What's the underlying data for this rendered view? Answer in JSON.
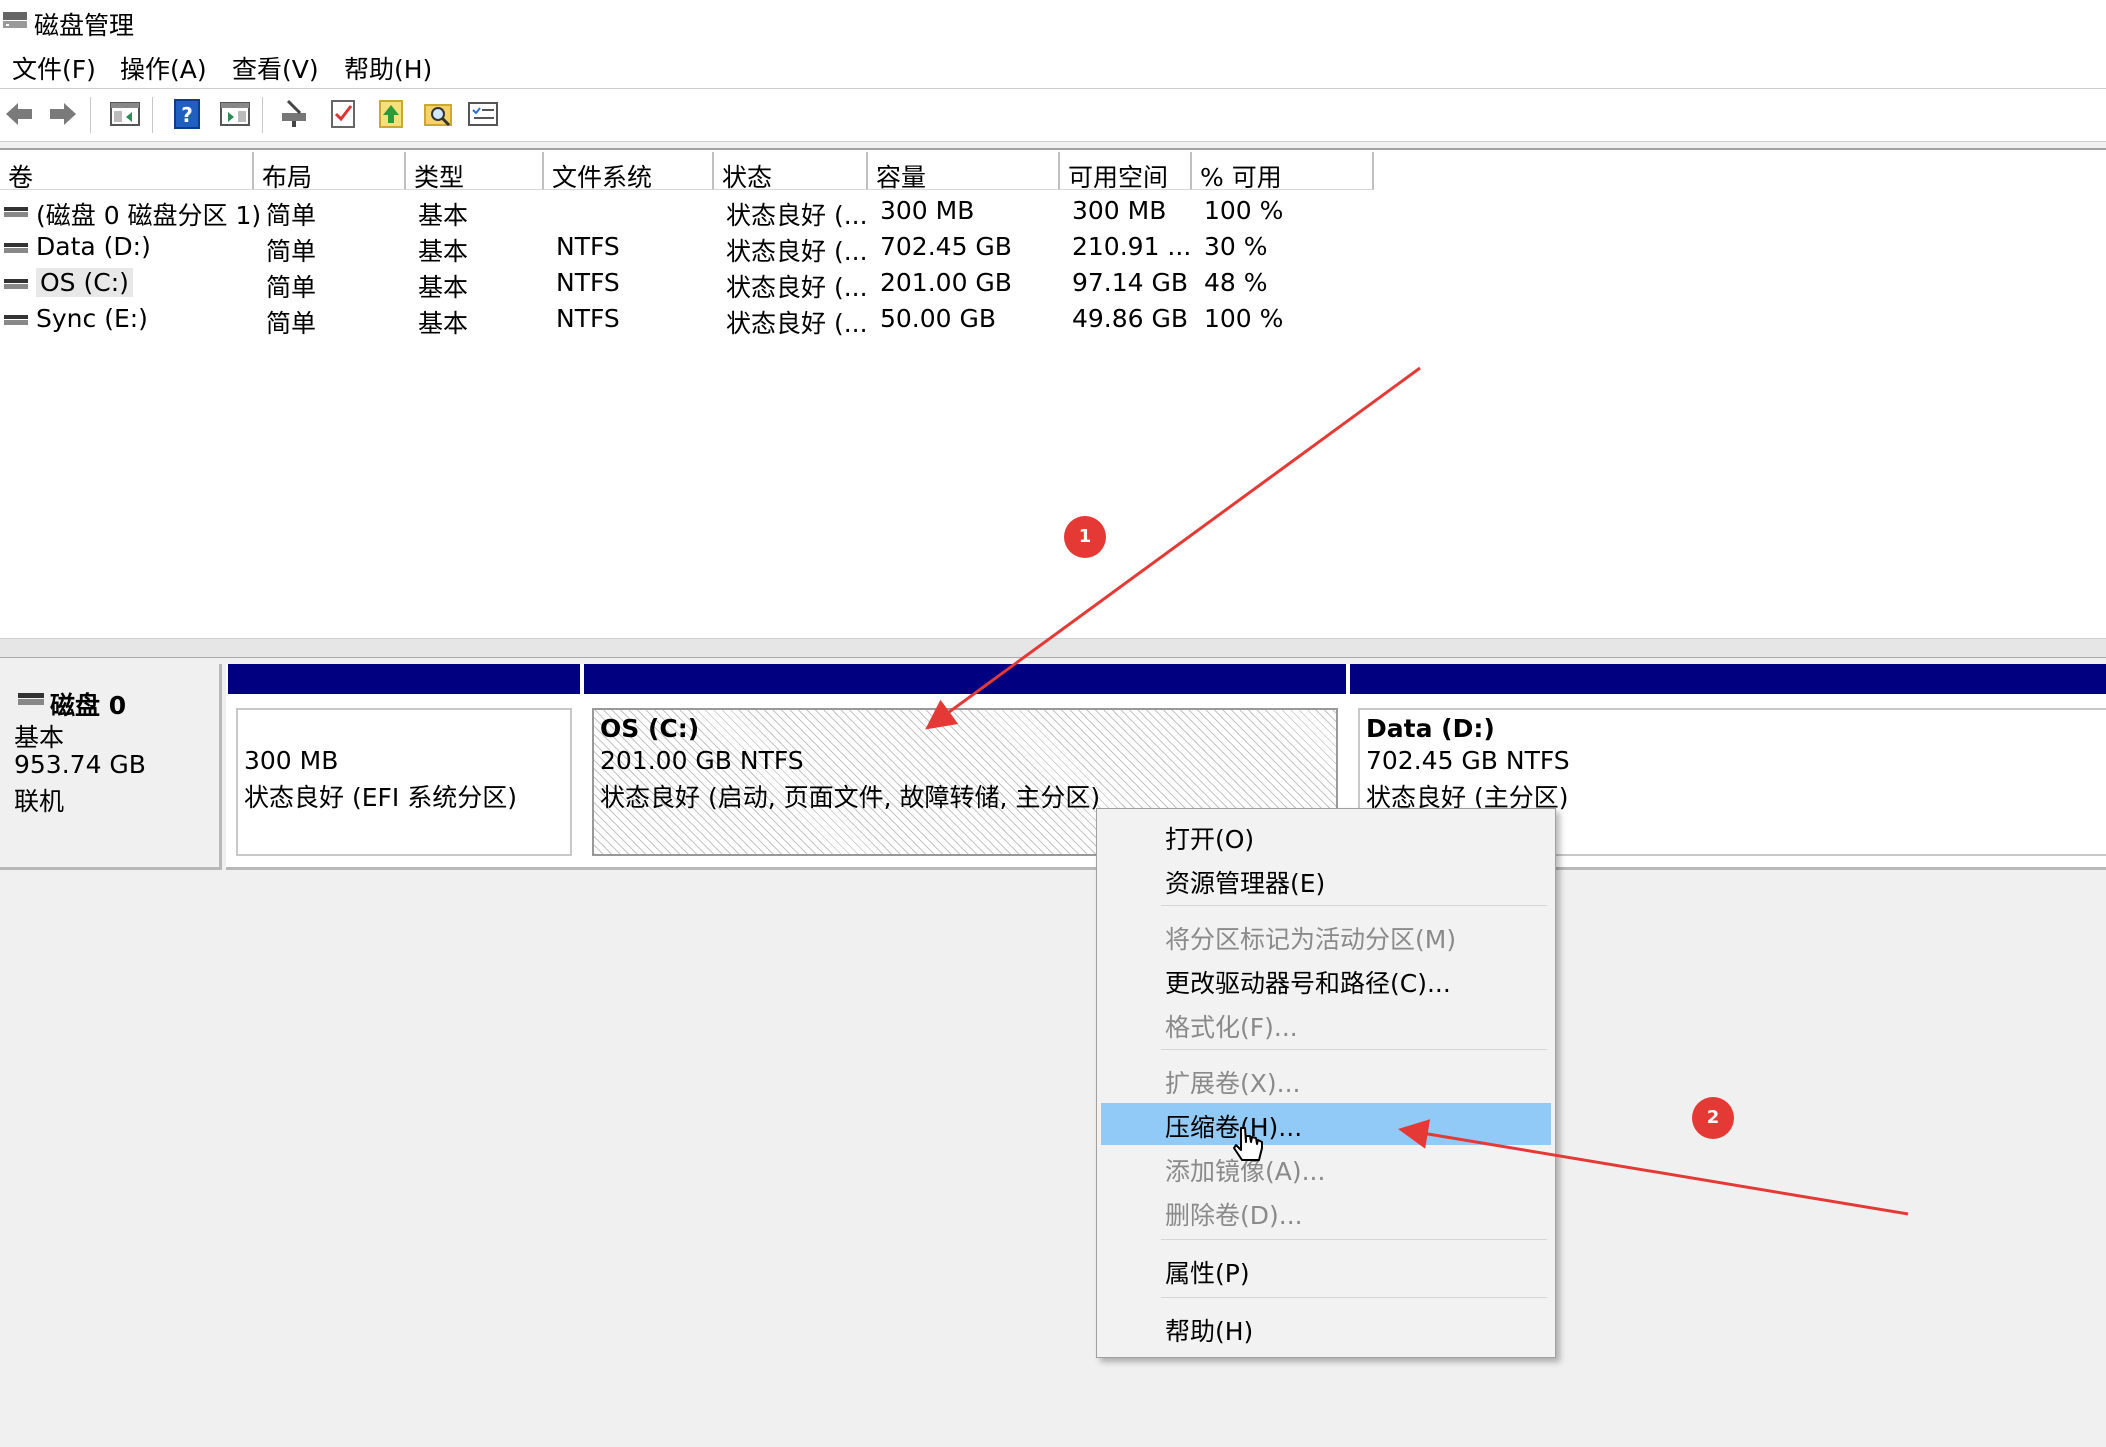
{
  "window": {
    "title": "磁盘管理"
  },
  "menubar": [
    "文件(F)",
    "操作(A)",
    "查看(V)",
    "帮助(H)"
  ],
  "toolbar": {
    "icons": [
      "back-arrow-icon",
      "forward-arrow-icon",
      "show-hide-console-tree-icon",
      "help-icon",
      "show-hide-action-pane-icon",
      "connect-virtual-disk-icon",
      "checklist-icon",
      "upload-icon",
      "search-folder-icon",
      "properties-list-icon"
    ]
  },
  "volume_list": {
    "columns": [
      "卷",
      "布局",
      "类型",
      "文件系统",
      "状态",
      "容量",
      "可用空间",
      "% 可用"
    ],
    "rows": [
      [
        "(磁盘 0 磁盘分区 1)",
        "简单",
        "基本",
        "",
        "状态良好 (...",
        "300 MB",
        "300 MB",
        "100 %"
      ],
      [
        "Data (D:)",
        "简单",
        "基本",
        "NTFS",
        "状态良好 (...",
        "702.45 GB",
        "210.91 ...",
        "30 %"
      ],
      [
        "OS (C:)",
        "简单",
        "基本",
        "NTFS",
        "状态良好 (...",
        "201.00 GB",
        "97.14 GB",
        "48 %"
      ],
      [
        "Sync (E:)",
        "简单",
        "基本",
        "NTFS",
        "状态良好 (...",
        "50.00 GB",
        "49.86 GB",
        "100 %"
      ]
    ]
  },
  "disk": {
    "name": "磁盘 0",
    "type": "基本",
    "size": "953.74 GB",
    "status": "联机",
    "partitions": [
      {
        "title": "",
        "line1": "300 MB",
        "line2": "状态良好 (EFI 系统分区)"
      },
      {
        "title": "OS  (C:)",
        "line1": "201.00 GB NTFS",
        "line2": "状态良好 (启动, 页面文件, 故障转储, 主分区)"
      },
      {
        "title": "Data  (D:)",
        "line1": "702.45 GB NTFS",
        "line2": "状态良好 (主分区)"
      }
    ]
  },
  "context_menu": {
    "items": [
      {
        "label": "打开(O)",
        "enabled": true
      },
      {
        "label": "资源管理器(E)",
        "enabled": true
      },
      {
        "label": "将分区标记为活动分区(M)",
        "enabled": false
      },
      {
        "label": "更改驱动器号和路径(C)...",
        "enabled": true
      },
      {
        "label": "格式化(F)...",
        "enabled": false
      },
      {
        "label": "扩展卷(X)...",
        "enabled": false
      },
      {
        "label": "压缩卷(H)...",
        "enabled": true,
        "highlighted": true
      },
      {
        "label": "添加镜像(A)...",
        "enabled": false
      },
      {
        "label": "删除卷(D)...",
        "enabled": false
      },
      {
        "label": "属性(P)",
        "enabled": true
      },
      {
        "label": "帮助(H)",
        "enabled": true
      }
    ]
  },
  "annotations": {
    "badges": [
      "1",
      "2"
    ],
    "arrow_color": "#e53935"
  },
  "colors": {
    "partition_header": "#000080",
    "menu_highlight": "#91c9f7"
  }
}
